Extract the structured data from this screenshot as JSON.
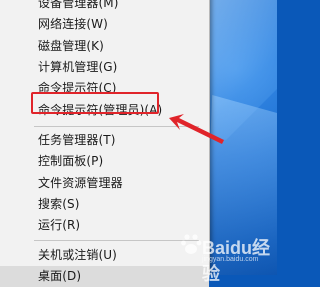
{
  "menu": {
    "items": [
      {
        "label": "设备管理器(M)"
      },
      {
        "label": "网络连接(W)"
      },
      {
        "label": "磁盘管理(K)"
      },
      {
        "label": "计算机管理(G)"
      },
      {
        "label": "命令提示符(C)"
      },
      {
        "label": "命令提示符(管理员)(A)"
      },
      {
        "label": "任务管理器(T)"
      },
      {
        "label": "控制面板(P)"
      },
      {
        "label": "文件资源管理器"
      },
      {
        "label": "搜索(S)"
      },
      {
        "label": "运行(R)"
      },
      {
        "label": "关机或注销(U)"
      },
      {
        "label": "桌面(D)"
      }
    ]
  },
  "annotation": {
    "highlight_color": "#e0242a"
  },
  "watermark": {
    "text": "Baidu经验",
    "sub": "jingyan.baidu.com"
  },
  "colors": {
    "menu_bg": "#f2f2f2",
    "desktop": "#0a58b8",
    "separator": "#c6c6c6"
  }
}
